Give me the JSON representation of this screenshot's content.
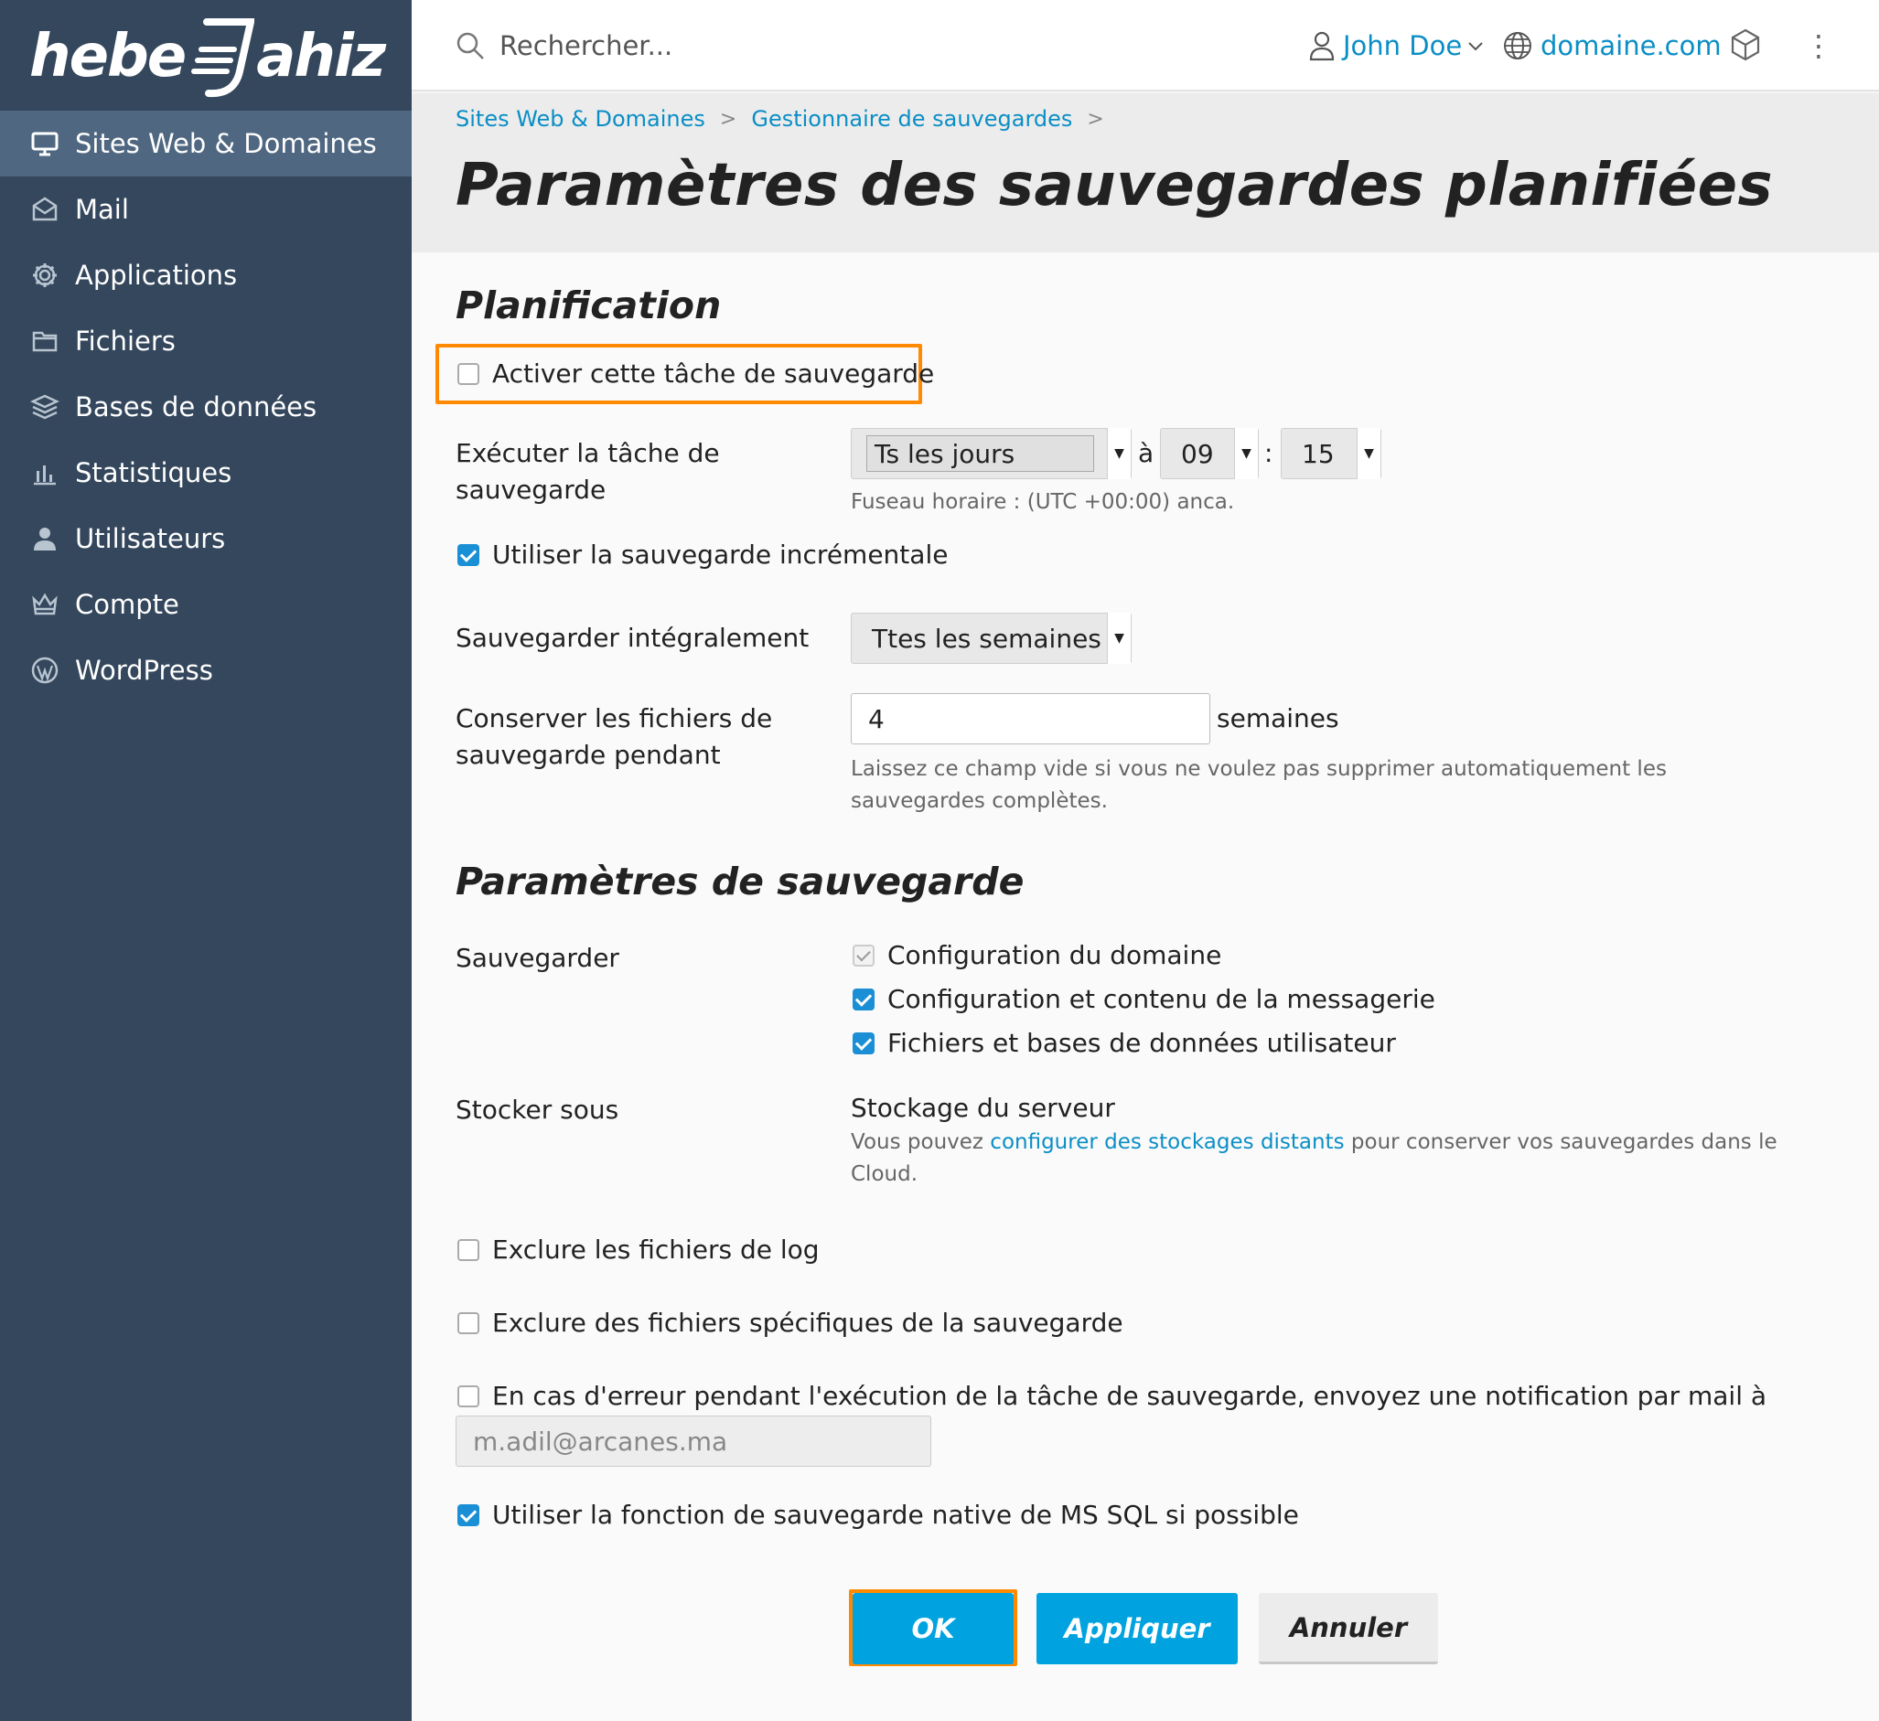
{
  "brand": {
    "logo_text_left": "hebe",
    "logo_text_right": "ahiz"
  },
  "sidebar": {
    "items": [
      {
        "label": "Sites Web & Domaines",
        "icon": "monitor-icon",
        "active": true
      },
      {
        "label": "Mail",
        "icon": "envelope-icon"
      },
      {
        "label": "Applications",
        "icon": "gear-icon"
      },
      {
        "label": "Fichiers",
        "icon": "folder-icon"
      },
      {
        "label": "Bases de données",
        "icon": "database-stack-icon"
      },
      {
        "label": "Statistiques",
        "icon": "bar-chart-icon"
      },
      {
        "label": "Utilisateurs",
        "icon": "user-icon"
      },
      {
        "label": "Compte",
        "icon": "crown-icon"
      },
      {
        "label": "WordPress",
        "icon": "wordpress-icon"
      }
    ]
  },
  "header": {
    "search_placeholder": "Rechercher...",
    "user_name": "John Doe",
    "domain": "domaine.com"
  },
  "breadcrumb": [
    "Sites Web & Domaines",
    "Gestionnaire de sauvegardes"
  ],
  "page_title": "Paramètres des sauvegardes planifiées",
  "planification": {
    "title": "Planification",
    "activate_label": "Activer cette tâche de sauvegarde",
    "activate_checked": false,
    "execute_label_line1": "Exécuter la tâche de",
    "execute_label_line2": "sauvegarde",
    "frequency_value": "Ts les jours",
    "at_label": "à",
    "hour_value": "09",
    "colon": ":",
    "minute_value": "15",
    "timezone_hint": "Fuseau horaire : (UTC +00:00) anca.",
    "incremental_label": "Utiliser la sauvegarde incrémentale",
    "incremental_checked": true,
    "full_backup_label": "Sauvegarder intégralement",
    "full_backup_value": "Ttes les semaines",
    "retention_label_line1": "Conserver les fichiers de",
    "retention_label_line2": "sauvegarde pendant",
    "retention_value": "4",
    "retention_unit": "semaines",
    "retention_hint_line1": "Laissez ce champ vide si vous ne voulez pas supprimer automatiquement les",
    "retention_hint_line2": "sauvegardes complètes."
  },
  "backup_settings": {
    "title": "Paramètres de sauvegarde",
    "backup_label": "Sauvegarder",
    "items": [
      {
        "label": "Configuration du domaine",
        "state": "disabled-checked"
      },
      {
        "label": "Configuration et contenu de la messagerie",
        "state": "checked"
      },
      {
        "label": "Fichiers et bases de données utilisateur",
        "state": "checked"
      }
    ],
    "store_label": "Stocker sous",
    "store_value": "Stockage du serveur",
    "store_hint_before": "Vous pouvez ",
    "store_hint_link": "configurer des stockages distants",
    "store_hint_after": " pour conserver vos sauvegardes dans le",
    "store_hint_line2": "Cloud.",
    "exclude_logs_label": "Exclure les fichiers de log",
    "exclude_specific_label": "Exclure des fichiers spécifiques de la sauvegarde",
    "notify_label": "En cas d'erreur pendant l'exécution de la tâche de sauvegarde, envoyez une notification par mail à",
    "notify_email": "m.adil@arcanes.ma",
    "mssql_label": "Utiliser la fonction de sauvegarde native de MS SQL si possible",
    "mssql_checked": true
  },
  "buttons": {
    "ok": "OK",
    "apply": "Appliquer",
    "cancel": "Annuler"
  },
  "colors": {
    "sidebar": "#34475c",
    "accent": "#00a3e0",
    "link": "#0b8ec5",
    "highlight": "#ff8a00"
  }
}
